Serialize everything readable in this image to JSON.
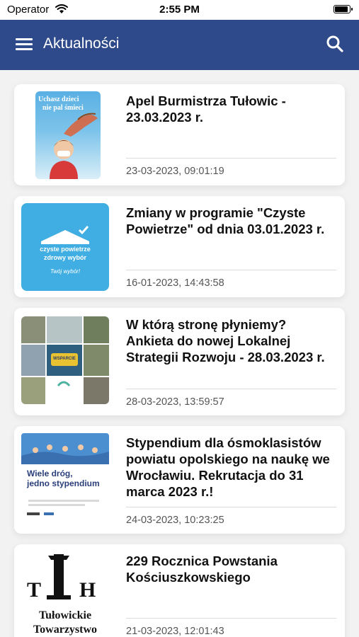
{
  "status": {
    "carrier": "Operator",
    "time": "2:55 PM",
    "battery_level": 0.95
  },
  "header": {
    "title": "Aktualności"
  },
  "articles": [
    {
      "title": "Apel Burmistrza Tułowic - 23.03.2023 r.",
      "date": "23-03-2023, 09:01:19",
      "thumb": {
        "line1": "Uchasz dzieci",
        "line2": "nie pal śmieci"
      }
    },
    {
      "title": "Zmiany w programie \"Czyste Powietrze\" od dnia 03.01.2023 r.",
      "date": "16-01-2023, 14:43:58",
      "thumb": {
        "line1": "czyste powietrze",
        "line2": "zdrowy wybór",
        "line3": "Twój wybór!"
      }
    },
    {
      "title": "W którą stronę płyniemy? Ankieta do nowej Lokalnej Strategii Rozwoju - 28.03.2023 r.",
      "date": "28-03-2023, 13:59:57",
      "thumb": {
        "label": "WSPARCIE"
      }
    },
    {
      "title": "Stypendium dla ósmoklasistów powiatu opolskiego na naukę we Wrocławiu. Rekrutacja do 31 marca 2023 r.!",
      "date": "24-03-2023, 10:23:25",
      "thumb": {
        "line1": "Wiele dróg,",
        "line2": "jedno stypendium"
      }
    },
    {
      "title": "229 Rocznica Powstania Kościuszkowskiego",
      "date": "21-03-2023, 12:01:43",
      "thumb": {
        "line1": "Tułowickie",
        "line2": "Towarzystwo"
      }
    }
  ]
}
